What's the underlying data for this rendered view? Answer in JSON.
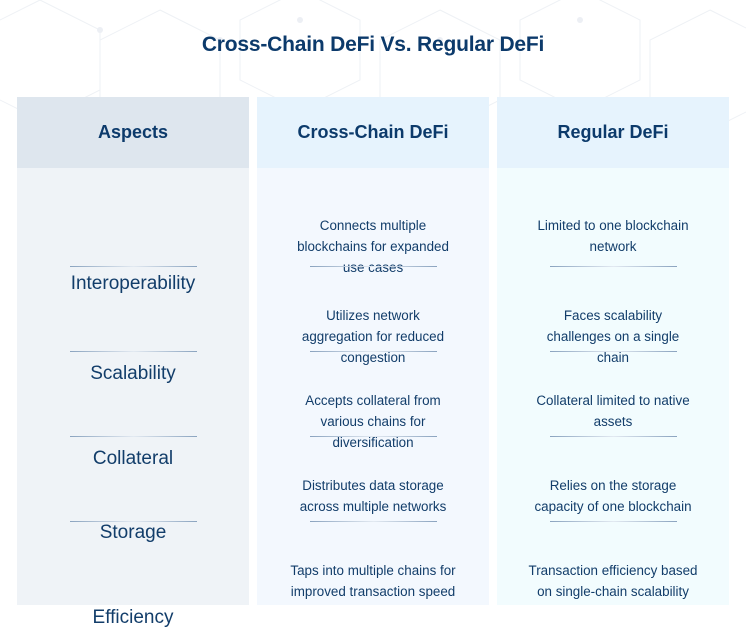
{
  "title": "Cross-Chain DeFi Vs. Regular DeFi",
  "columns": {
    "aspects": "Aspects",
    "cross_chain": "Cross-Chain DeFi",
    "regular": "Regular DeFi"
  },
  "rows": [
    {
      "aspect": "Interoperability",
      "cross_chain": [
        "Connects multiple",
        "blockchains for expanded",
        "use cases"
      ],
      "regular": [
        "Limited to one blockchain",
        "network"
      ]
    },
    {
      "aspect": "Scalability",
      "cross_chain": [
        "Utilizes network",
        "aggregation for reduced",
        "congestion"
      ],
      "regular": [
        "Faces scalability",
        "challenges on a single",
        "chain"
      ]
    },
    {
      "aspect": "Collateral",
      "cross_chain": [
        "Accepts collateral from",
        "various chains for",
        "diversification"
      ],
      "regular": [
        "Collateral limited to native",
        "assets"
      ]
    },
    {
      "aspect": "Storage",
      "cross_chain": [
        "Distributes data storage",
        "across multiple networks"
      ],
      "regular": [
        "Relies on the storage",
        "capacity of one blockchain"
      ]
    },
    {
      "aspect": "Efficiency",
      "cross_chain": [
        "Taps into multiple chains for",
        "improved transaction speed"
      ],
      "regular": [
        "Transaction efficiency based",
        "on single-chain scalability"
      ]
    }
  ],
  "colors": {
    "title": "#0c3a6b",
    "text": "#123d6a",
    "aspects_header_bg": "#dee6ee",
    "aspects_body_bg": "#eff3f7",
    "cross_header_bg": "#e6f3fd",
    "cross_body_bg": "#f3f8fe",
    "regular_header_bg": "#e6f3fd",
    "regular_body_bg": "#f2fcfe"
  }
}
